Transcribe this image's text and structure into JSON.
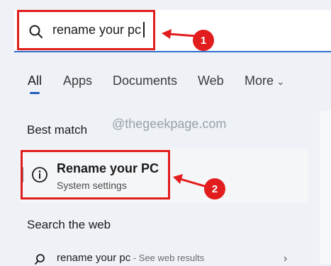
{
  "search": {
    "query": "rename your pc"
  },
  "tabs": [
    {
      "label": "All"
    },
    {
      "label": "Apps"
    },
    {
      "label": "Documents"
    },
    {
      "label": "Web"
    },
    {
      "label": "More"
    }
  ],
  "best_match": {
    "heading": "Best match",
    "title": "Rename your PC",
    "subtitle": "System settings"
  },
  "watermark": "@thegeekpage.com",
  "search_web": {
    "heading": "Search the web",
    "query": "rename your pc",
    "suffix": " - See web results"
  },
  "annotations": {
    "badge1": "1",
    "badge2": "2",
    "color": "#e11d1d"
  },
  "icons": [
    "search-icon",
    "info-icon",
    "chevron-down-icon",
    "chevron-right-icon"
  ]
}
